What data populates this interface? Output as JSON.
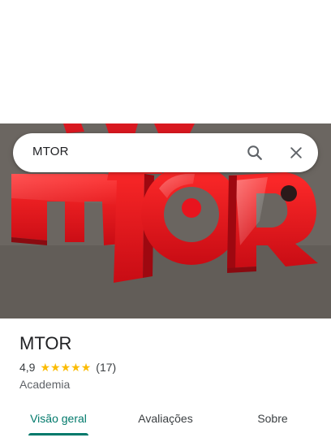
{
  "search": {
    "query": "MTOR"
  },
  "place": {
    "name": "MTOR",
    "rating": "4,9",
    "review_count": "(17)",
    "category": "Academia",
    "stars": 5
  },
  "tabs": [
    {
      "label": "Visão geral",
      "active": true
    },
    {
      "label": "Avaliações",
      "active": false
    },
    {
      "label": "Sobre",
      "active": false
    }
  ],
  "hero": {
    "logo_text": "MTOR",
    "colors": {
      "sign_red": "#e8141e",
      "wall_gray": "#6d6863"
    }
  },
  "colors": {
    "accent": "#00796b",
    "star": "#fbbc04",
    "text_primary": "#202124",
    "text_secondary": "#5f6368"
  }
}
